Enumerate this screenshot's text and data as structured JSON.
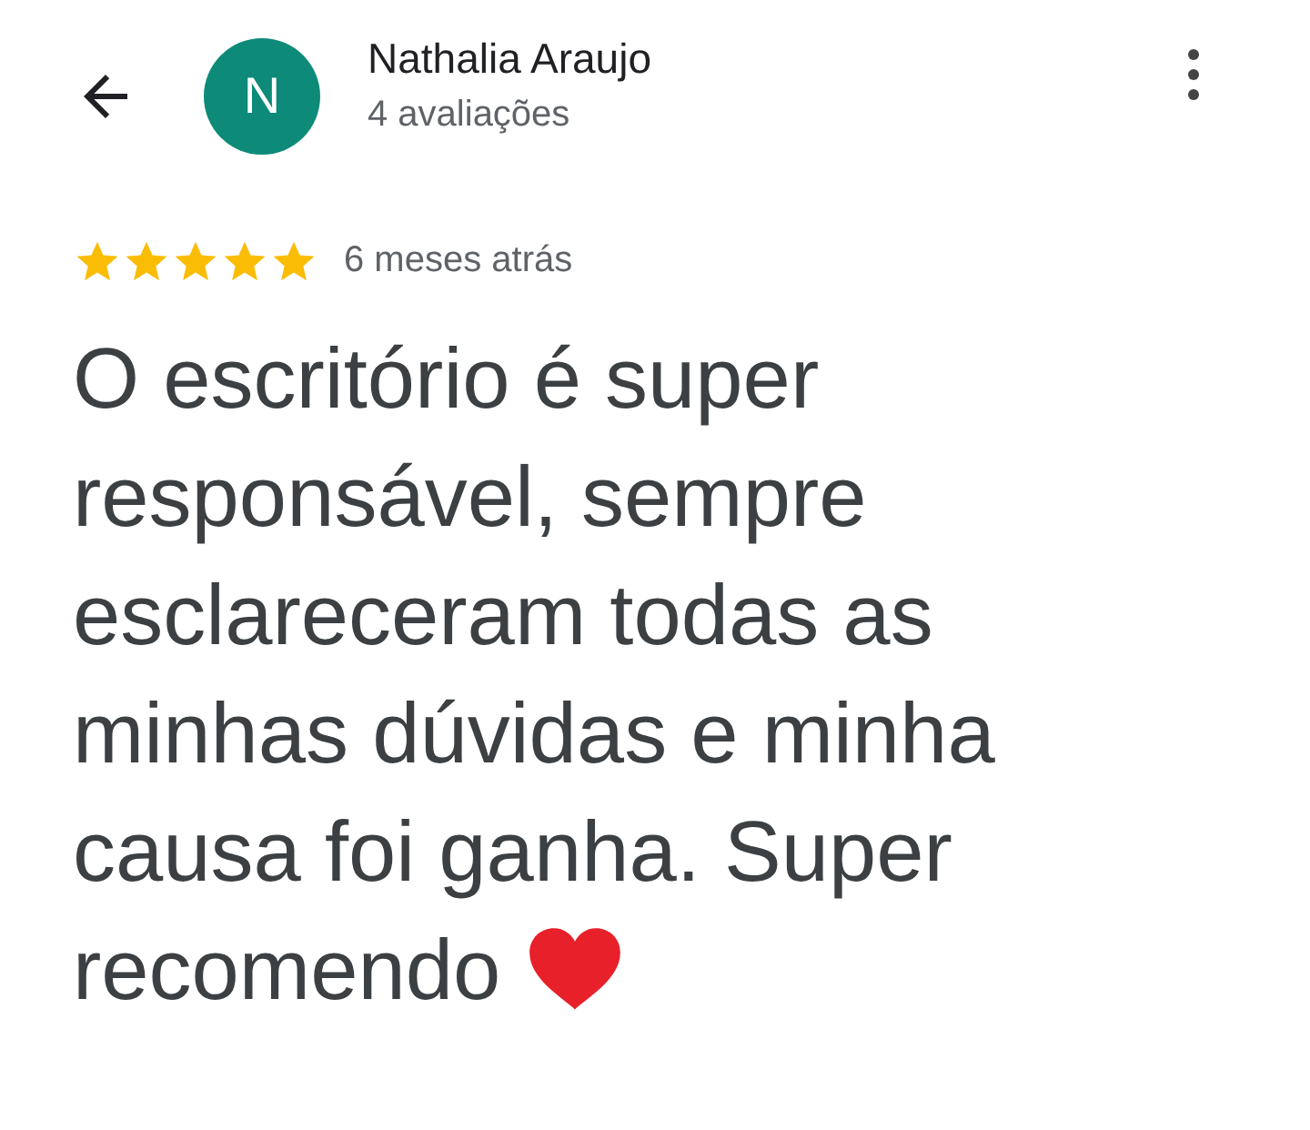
{
  "reviewer": {
    "initial": "N",
    "name": "Nathalia Araujo",
    "review_count": "4 avaliações"
  },
  "review": {
    "stars": 5,
    "time": "6 meses atrás",
    "text": "O escritório é super responsável, sempre esclareceram todas as minhas dúvidas e minha causa foi ganha. Super",
    "closing": "recomendo"
  }
}
